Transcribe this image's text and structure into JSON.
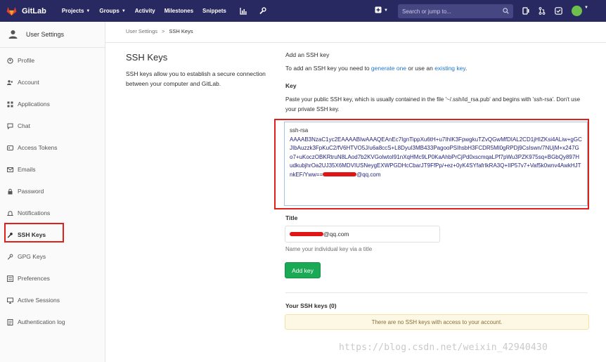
{
  "navbar": {
    "brand": "GitLab",
    "items": [
      {
        "label": "Projects",
        "dropdown": true
      },
      {
        "label": "Groups",
        "dropdown": true
      },
      {
        "label": "Activity",
        "dropdown": false
      },
      {
        "label": "Milestones",
        "dropdown": false
      },
      {
        "label": "Snippets",
        "dropdown": false
      }
    ],
    "search_placeholder": "Search or jump to...",
    "colors": {
      "bg": "#292961",
      "accent": "#e24329"
    }
  },
  "sidebar": {
    "header": "User Settings",
    "items": [
      {
        "label": "Profile",
        "icon": "user-icon"
      },
      {
        "label": "Account",
        "icon": "users-icon"
      },
      {
        "label": "Applications",
        "icon": "applications-icon"
      },
      {
        "label": "Chat",
        "icon": "chat-icon"
      },
      {
        "label": "Access Tokens",
        "icon": "key-card-icon"
      },
      {
        "label": "Emails",
        "icon": "mail-icon"
      },
      {
        "label": "Password",
        "icon": "lock-icon"
      },
      {
        "label": "Notifications",
        "icon": "bell-icon"
      },
      {
        "label": "SSH Keys",
        "icon": "key-icon",
        "active": true
      },
      {
        "label": "GPG Keys",
        "icon": "key-icon"
      },
      {
        "label": "Preferences",
        "icon": "preferences-icon"
      },
      {
        "label": "Active Sessions",
        "icon": "monitor-icon"
      },
      {
        "label": "Authentication log",
        "icon": "log-icon"
      }
    ]
  },
  "breadcrumb": {
    "parent": "User Settings",
    "separator": ">",
    "current": "SSH Keys"
  },
  "page": {
    "title": "SSH Keys",
    "description": "SSH keys allow you to establish a secure connection between your computer and GitLab."
  },
  "form": {
    "add_title": "Add an SSH key",
    "add_intro_prefix": "To add an SSH key you need to ",
    "generate_link": "generate one",
    "intro_middle": " or use an ",
    "existing_link": "existing key",
    "intro_suffix": ".",
    "key_label": "Key",
    "key_help": "Paste your public SSH key, which is usually contained in the file '~/.ssh/id_rsa.pub' and begins with 'ssh-rsa'. Don't use your private SSH key.",
    "key_first_line": "ssh-rsa",
    "key_value": "AAAAB3NzaC1yc2EAAAABIwAAAQEAnEc7IgnTippXu6tH+u7IhIK3FpwgkuTZvQGwMfDIAL2CD1jHIZKsi4ALiw+gGCJIbAuzzk3FpKuC2/fV6HTVO5J/u6a8ccS+L8DyuI3MB433PagooPSIhsbH3FCDR5Ml0gRPDj9CsIswn/7NUjM+x247Go7+uKoczOBKRtruN8LAod7b2KVGolwtoI91nXqHMc9LP0KaAhbPrCjPd0xscmqaLPf7pWu3PZK975sq+BGbQy897HudkubjhrOa2UJ35X6MDVIUSNeygEXWPGDHcCbarJT9FfPp/+ez+0yK4SYfafrIkRA3Q+IIP57v7+Vaf5k0wnv4AwkHJTnkEF/Yww==",
    "key_suffix": "@qq.com",
    "title_label": "Title",
    "title_value_suffix": "@qq.com",
    "title_help": "Name your individual key via a title",
    "submit_label": "Add key"
  },
  "keys_section": {
    "heading": "Your SSH keys (0)",
    "empty_message": "There are no SSH keys with access to your account."
  },
  "watermark": "https://blog.csdn.net/weixin_42940430"
}
